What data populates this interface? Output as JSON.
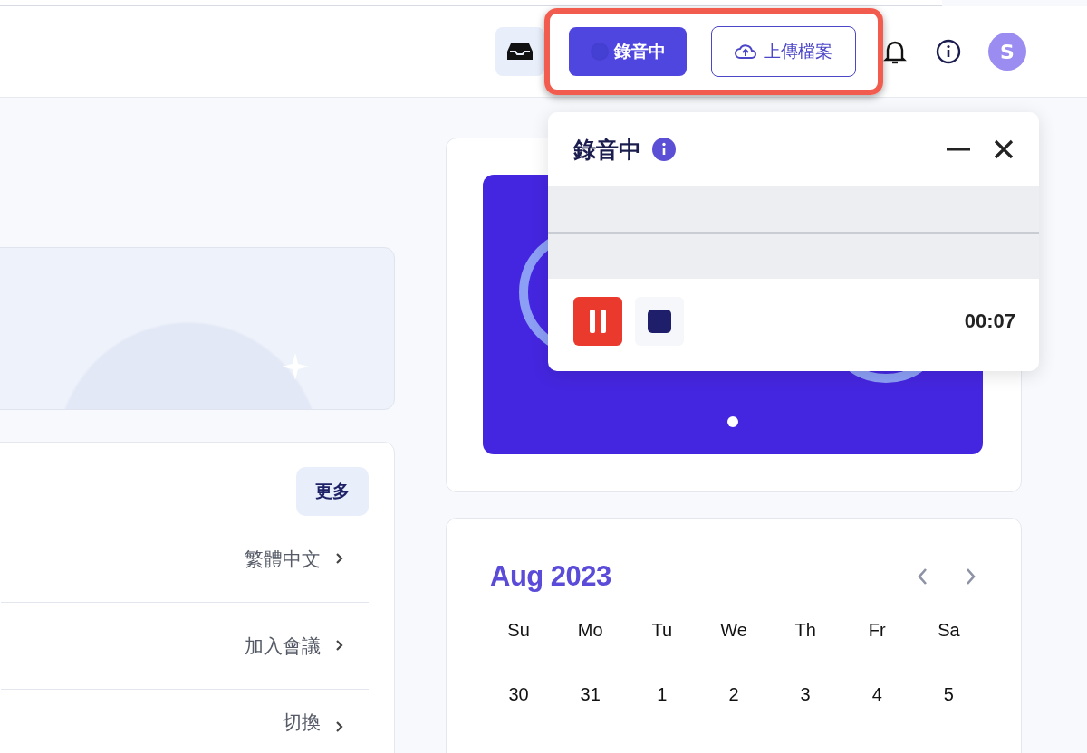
{
  "header": {
    "record_button": "錄音中",
    "upload_button": "上傳檔案",
    "avatar": "S"
  },
  "recorder": {
    "title": "錄音中",
    "timer": "00:07"
  },
  "list_card": {
    "more_button": "更多",
    "items": [
      "繁體中文",
      "加入會議",
      "切換"
    ]
  },
  "calendar": {
    "month": "Aug 2023",
    "weekdays": [
      "Su",
      "Mo",
      "Tu",
      "We",
      "Th",
      "Fr",
      "Sa"
    ],
    "dates": [
      "30",
      "31",
      "1",
      "2",
      "3",
      "4",
      "5"
    ]
  }
}
